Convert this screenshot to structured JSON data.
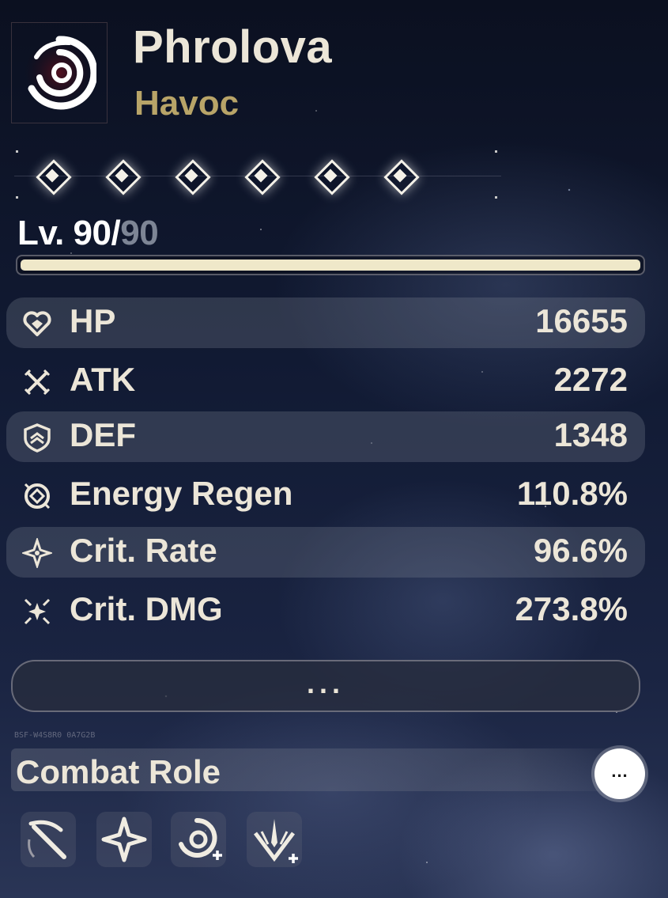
{
  "character": {
    "name": "Phrolova",
    "element": "Havoc",
    "emblem_icon": "havoc-spiral-icon"
  },
  "sequence": {
    "nodes_unlocked": 6,
    "nodes_total": 6,
    "node_icon": "diamond-icon"
  },
  "level": {
    "current": "90",
    "separator": "/",
    "max": "90",
    "prefix": "Lv. ",
    "progress": 1.0
  },
  "stats": [
    {
      "label": "HP",
      "value": "16655",
      "icon": "heart-icon"
    },
    {
      "label": "ATK",
      "value": "2272",
      "icon": "crossed-swords-icon"
    },
    {
      "label": "DEF",
      "value": "1348",
      "icon": "shield-icon"
    },
    {
      "label": "Energy Regen",
      "value": "110.8%",
      "icon": "energy-regen-icon"
    },
    {
      "label": "Crit. Rate",
      "value": "96.6%",
      "icon": "sparkle-icon"
    },
    {
      "label": "Crit. DMG",
      "value": "273.8%",
      "icon": "burst-sparkle-icon"
    }
  ],
  "more_button": {
    "label": "..."
  },
  "watermark": "BSF-W4S8R0 0A7G2B",
  "combat_role": {
    "title": "Combat Role",
    "more_label": "...",
    "roles": [
      {
        "icon": "scythe-blade-icon"
      },
      {
        "icon": "crit-star-icon"
      },
      {
        "icon": "havoc-spiral-plus-icon"
      },
      {
        "icon": "sword-burst-plus-icon"
      }
    ]
  },
  "colors": {
    "name": "#ece6d8",
    "element": "#b8a468",
    "level_max": "#7d8595",
    "level_fill": "#efe8c9"
  }
}
